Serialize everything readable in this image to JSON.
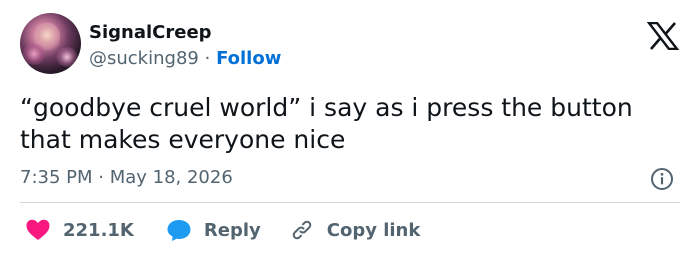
{
  "author": {
    "display_name": "SignalCreep",
    "handle": "@sucking89",
    "separator": "·",
    "follow_label": "Follow"
  },
  "tweet": {
    "text": "“goodbye cruel world” i say as i press the button that makes everyone nice",
    "timestamp": "7:35 PM · May 18, 2026"
  },
  "actions": {
    "like_count": "221.1K",
    "reply_label": "Reply",
    "copy_link_label": "Copy link"
  },
  "icons": {
    "brand": "x-logo-icon",
    "info": "info-icon",
    "like": "heart-icon",
    "reply": "speech-bubble-icon",
    "copy_link": "link-icon"
  },
  "colors": {
    "like": "#f91880",
    "reply": "#1d9bf0",
    "follow": "#006fd6",
    "secondary_text": "#536471"
  }
}
